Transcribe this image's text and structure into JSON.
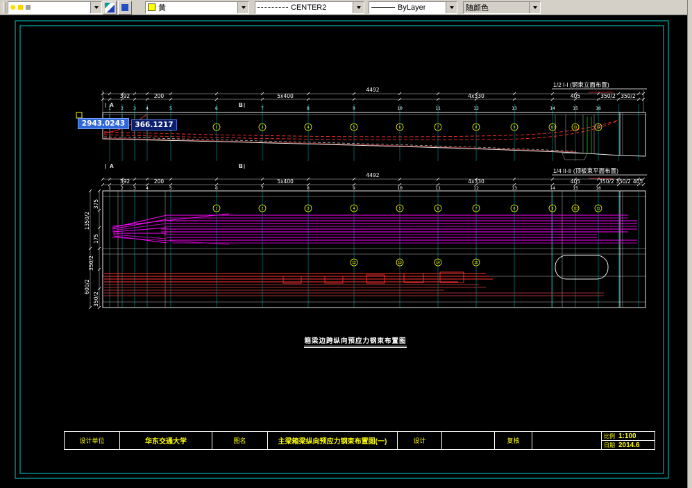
{
  "toolbar": {
    "color_label": "黄",
    "linetype_label": "CENTER2",
    "lineweight_label": "ByLayer",
    "plotstyle_label": "随颜色"
  },
  "tooltip": {
    "value_x": "2943.0243",
    "value_y": "366.1217"
  },
  "elevation": {
    "view_label": "1/2 I-I (钢束立面布置)",
    "dim_total": "4492",
    "dim_392": "392",
    "dim_200": "200",
    "dim_5x400": "5x400",
    "dim_4x330": "4x330",
    "dim_405": "405",
    "dim_350a": "350/2",
    "dim_350b": "350/2",
    "section_a": "A",
    "section_b": "B",
    "stations": [
      "1",
      "2",
      "3",
      "4",
      "5",
      "6",
      "7",
      "8",
      "9",
      "10",
      "11",
      "12",
      "13",
      "14",
      "15",
      "16"
    ],
    "markers": [
      "1",
      "2",
      "3",
      "4",
      "5",
      "6",
      "7",
      "8",
      "9",
      "10",
      "11",
      "12"
    ]
  },
  "plan": {
    "view_label": "1/4 II-II (顶板束平面布置)",
    "dim_total": "4492",
    "dim_392": "392",
    "dim_200": "200",
    "dim_5x400": "5x400",
    "dim_4x330": "4x330",
    "dim_405": "405",
    "dim_350a": "350/2",
    "dim_350b": "350/2",
    "dim_405b": "405",
    "left_dims": [
      "1350/2",
      "375",
      "175",
      "350/2",
      "600/2",
      "350/2"
    ],
    "section_a": "A",
    "section_b": "B",
    "stations": [
      "1",
      "2",
      "3",
      "4",
      "5",
      "6",
      "7",
      "8",
      "9",
      "10",
      "11",
      "12",
      "13",
      "14",
      "15",
      "16"
    ],
    "markers": [
      "1",
      "2",
      "3",
      "4",
      "5",
      "6",
      "7",
      "8",
      "9",
      "10",
      "11"
    ],
    "markers2": [
      "12",
      "13",
      "14",
      "15"
    ]
  },
  "caption": "箱梁边跨纵向预应力钢束布置图",
  "title_block": {
    "c1": "设计单位",
    "c2": "华东交通大学",
    "c3": "图名",
    "c4": "主梁箱梁纵向预应力钢束布置图(一)",
    "c5": "设计",
    "c6": "",
    "c7": "复核",
    "c8": "",
    "scale_label": "比例",
    "scale_value": "1:100",
    "date_label": "日期",
    "date_value": "2014.6"
  }
}
